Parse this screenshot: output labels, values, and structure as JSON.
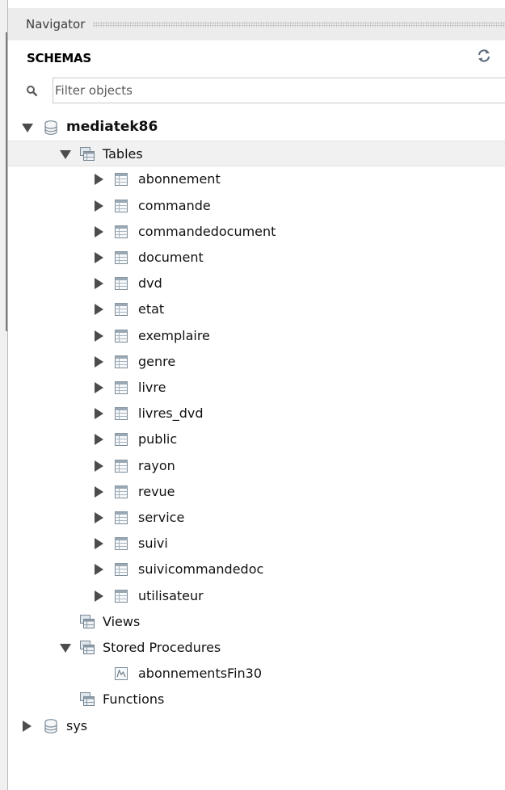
{
  "navigator": {
    "title": "Navigator"
  },
  "schemas": {
    "title": "SCHEMAS",
    "refresh_icon": "refresh-icon"
  },
  "search": {
    "placeholder": "Filter objects",
    "icon": "search-icon"
  },
  "tree": {
    "schema1": {
      "name": "mediatek86",
      "tables_label": "Tables",
      "tables": [
        "abonnement",
        "commande",
        "commandedocument",
        "document",
        "dvd",
        "etat",
        "exemplaire",
        "genre",
        "livre",
        "livres_dvd",
        "public",
        "rayon",
        "revue",
        "service",
        "suivi",
        "suivicommandedoc",
        "utilisateur"
      ],
      "views_label": "Views",
      "procedures_label": "Stored Procedures",
      "procedures": [
        "abonnementsFin30"
      ],
      "functions_label": "Functions"
    },
    "schema2": {
      "name": "sys"
    }
  },
  "colors": {
    "header_bg": "#ececec",
    "selected_bg": "#f1f1f1",
    "arrow": "#4c4c4c"
  }
}
